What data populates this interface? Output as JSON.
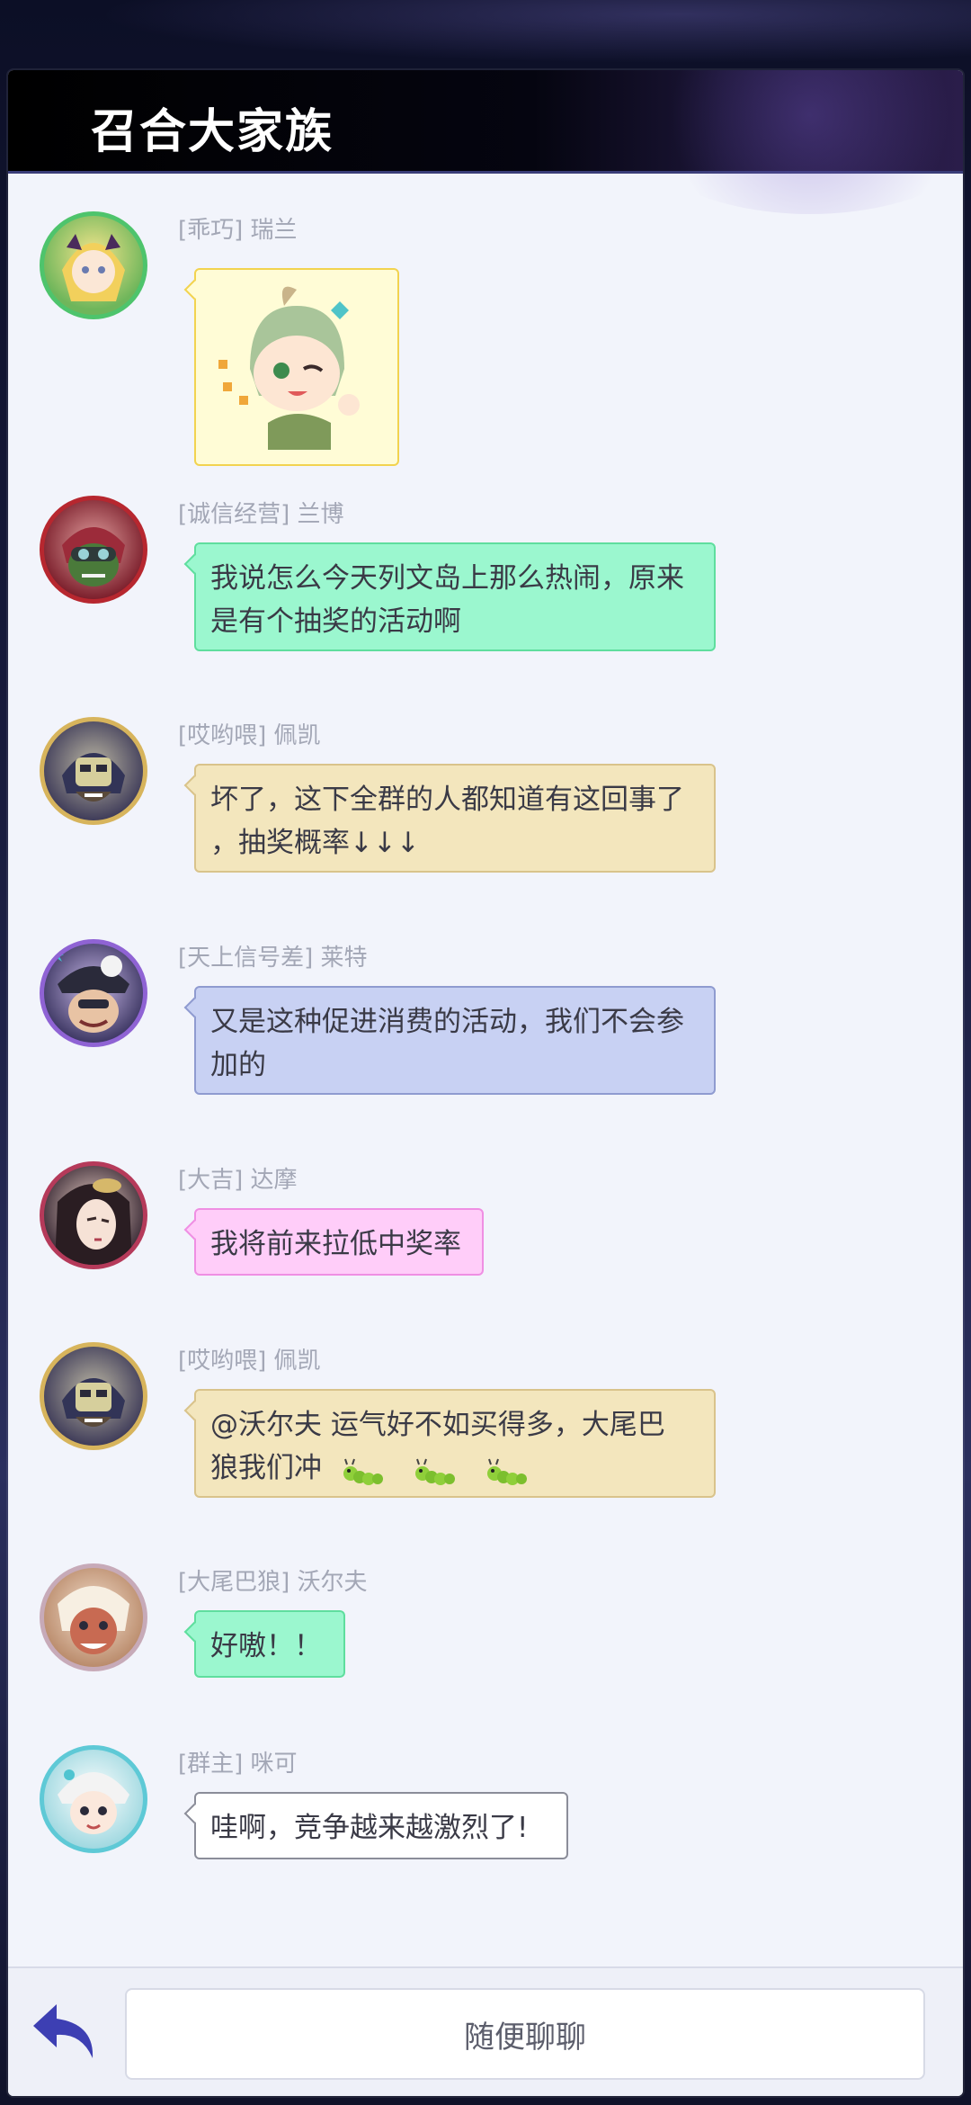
{
  "header": {
    "title": "召合大家族"
  },
  "messages": [
    {
      "name": "[乖巧] 瑞兰",
      "type": "sticker",
      "avatar": "rui-lan-avatar"
    },
    {
      "name": "[诚信经营] 兰博",
      "line1": "我说怎么今天列文岛上那么热闹，原来",
      "line2": "是有个抽奖的活动啊"
    },
    {
      "name": "[哎哟喂] 佩凯",
      "line1": "坏了，这下全群的人都知道有这回事了",
      "line2": "，抽奖概率↓↓↓"
    },
    {
      "name": "[天上信号差] 莱特",
      "line1": "又是这种促进消费的活动，我们不会参",
      "line2": "加的"
    },
    {
      "name": "[大吉] 达摩",
      "line1": "我将前来拉低中奖率"
    },
    {
      "name": "[哎哟喂] 佩凯",
      "line1": "@沃尔夫 运气好不如买得多，大尾巴",
      "line2": "狼我们冲",
      "emoji": "caterpillar-emoji"
    },
    {
      "name": "[大尾巴狼] 沃尔夫",
      "line1": "好嗷！！"
    },
    {
      "name": "[群主] 咪可",
      "line1": "哇啊，竞争越来越激烈了!"
    }
  ],
  "footer": {
    "input_placeholder": "随便聊聊",
    "back_icon": "back-arrow-icon"
  },
  "colors": {
    "green_bubble": "#9bf7cf",
    "yellow_bubble": "#f3e6bd",
    "blue_bubble": "#c8d1f3",
    "pink_bubble": "#ffcdf9",
    "white_bubble": "#ffffff",
    "sticker_bubble": "#fffcd6",
    "accent": "#3d3fb3"
  }
}
